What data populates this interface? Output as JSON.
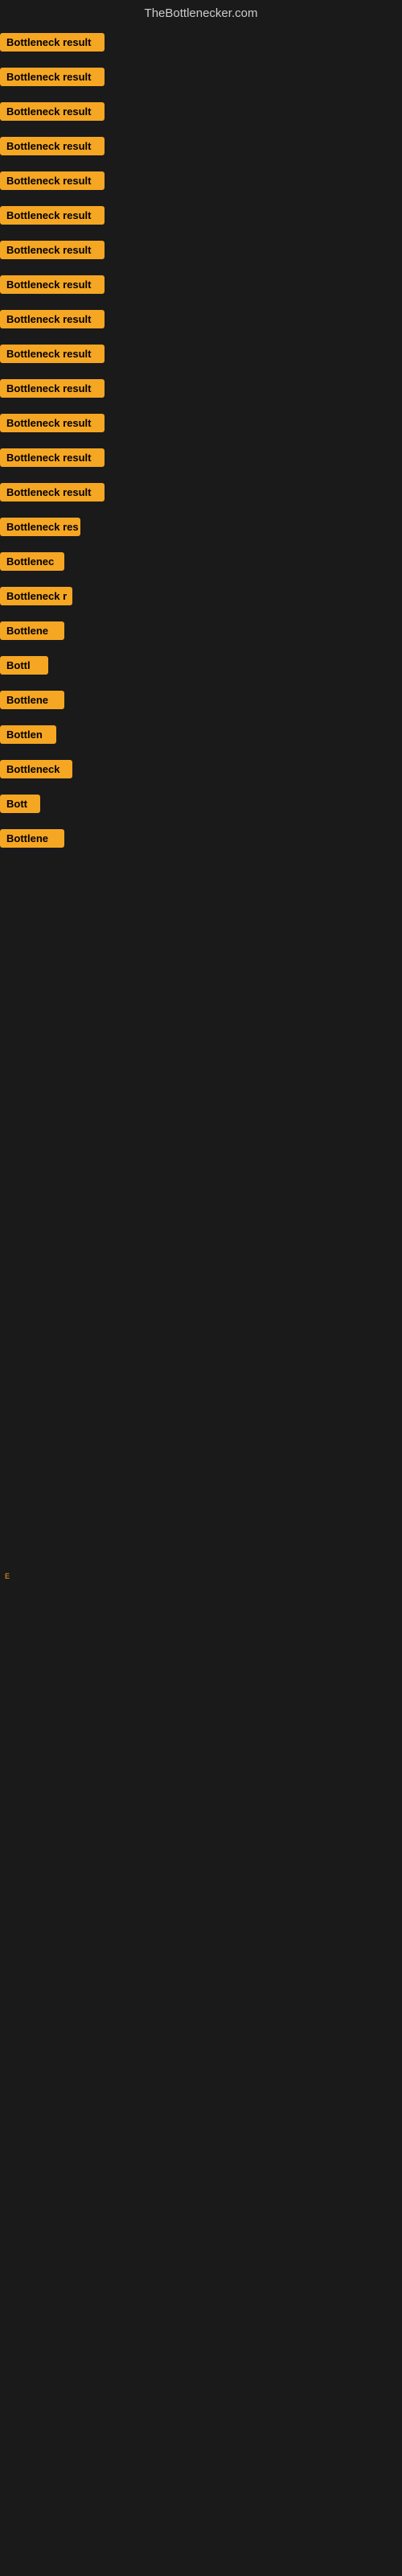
{
  "header": {
    "title": "TheBottlenecker.com"
  },
  "items": [
    {
      "id": 1,
      "label": "Bottleneck result",
      "widthClass": "w-full"
    },
    {
      "id": 2,
      "label": "Bottleneck result",
      "widthClass": "w-full"
    },
    {
      "id": 3,
      "label": "Bottleneck result",
      "widthClass": "w-full"
    },
    {
      "id": 4,
      "label": "Bottleneck result",
      "widthClass": "w-full"
    },
    {
      "id": 5,
      "label": "Bottleneck result",
      "widthClass": "w-full"
    },
    {
      "id": 6,
      "label": "Bottleneck result",
      "widthClass": "w-full"
    },
    {
      "id": 7,
      "label": "Bottleneck result",
      "widthClass": "w-full"
    },
    {
      "id": 8,
      "label": "Bottleneck result",
      "widthClass": "w-full"
    },
    {
      "id": 9,
      "label": "Bottleneck result",
      "widthClass": "w-full"
    },
    {
      "id": 10,
      "label": "Bottleneck result",
      "widthClass": "w-full"
    },
    {
      "id": 11,
      "label": "Bottleneck result",
      "widthClass": "w-full"
    },
    {
      "id": 12,
      "label": "Bottleneck result",
      "widthClass": "w-full"
    },
    {
      "id": 13,
      "label": "Bottleneck result",
      "widthClass": "w-full"
    },
    {
      "id": 14,
      "label": "Bottleneck result",
      "widthClass": "w-full"
    },
    {
      "id": 15,
      "label": "Bottleneck res",
      "widthClass": "w-partial1"
    },
    {
      "id": 16,
      "label": "Bottlenec",
      "widthClass": "w-partial2"
    },
    {
      "id": 17,
      "label": "Bottleneck r",
      "widthClass": "w-partial3"
    },
    {
      "id": 18,
      "label": "Bottlene",
      "widthClass": "w-partial2"
    },
    {
      "id": 19,
      "label": "Bottl",
      "widthClass": "w-partial4"
    },
    {
      "id": 20,
      "label": "Bottlene",
      "widthClass": "w-partial2"
    },
    {
      "id": 21,
      "label": "Bottlen",
      "widthClass": "w-partial5"
    },
    {
      "id": 22,
      "label": "Bottleneck",
      "widthClass": "w-partial3"
    },
    {
      "id": 23,
      "label": "Bott",
      "widthClass": "w-partial8"
    },
    {
      "id": 24,
      "label": "Bottlene",
      "widthClass": "w-partial2"
    }
  ],
  "bottom_label": "E"
}
